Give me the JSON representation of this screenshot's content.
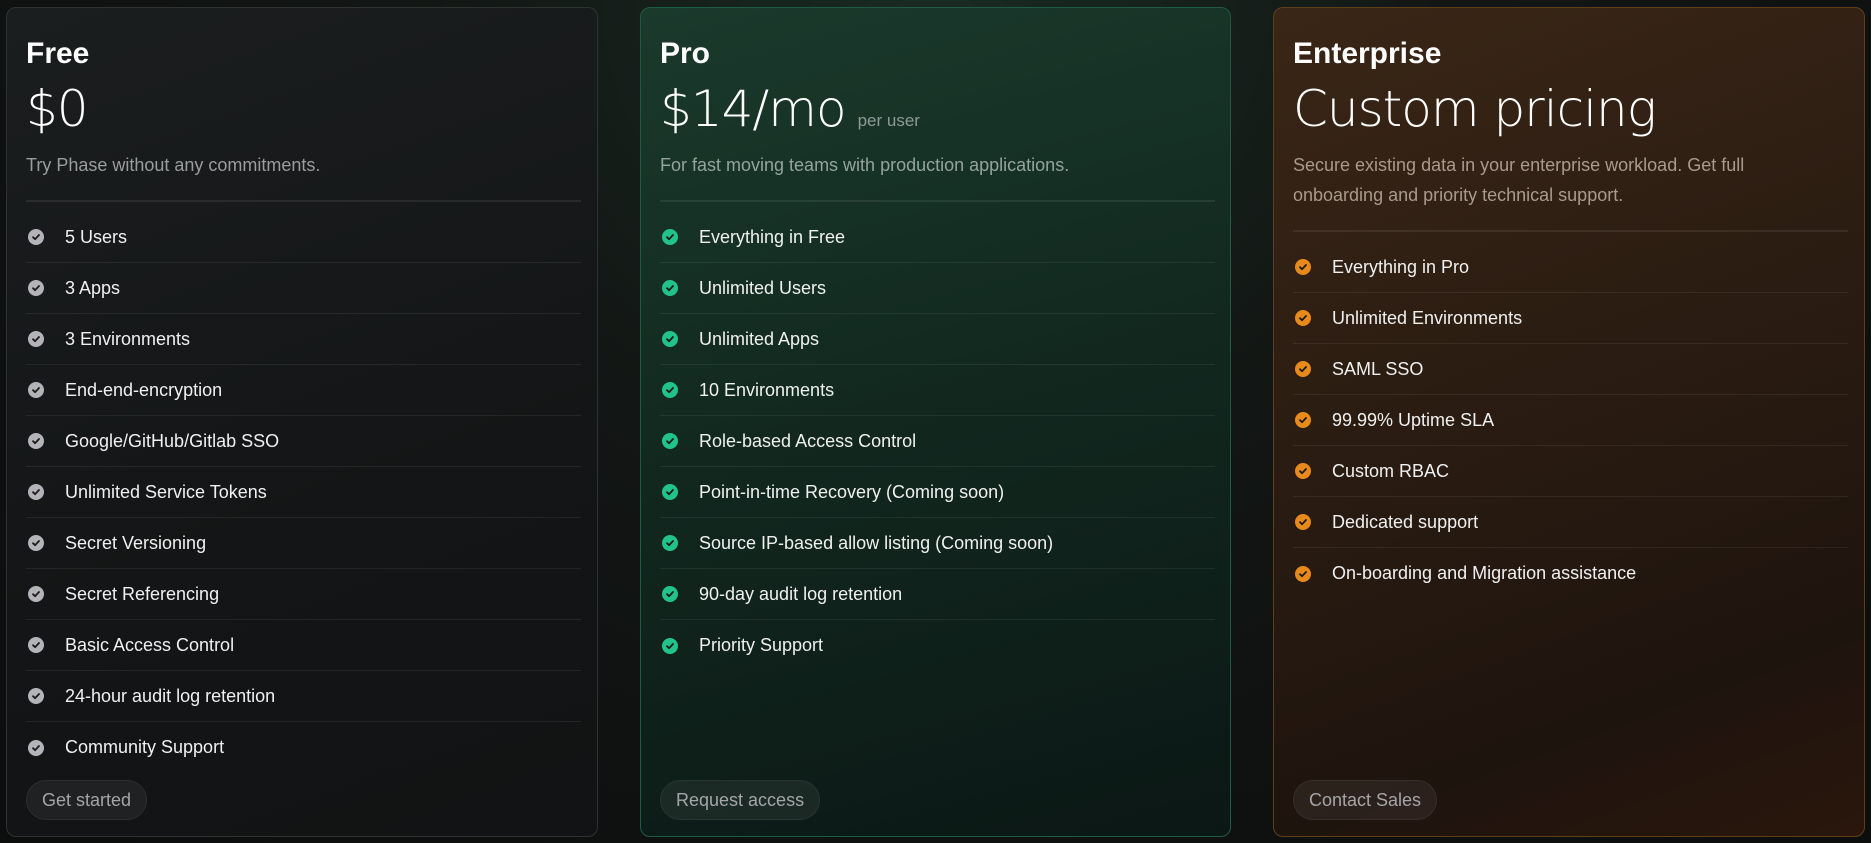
{
  "plans": [
    {
      "name": "Free",
      "price": "$0",
      "price_suffix": "",
      "description": "Try Phase without any commitments.",
      "accent_color": "#b4b4b8",
      "features": [
        "5 Users",
        "3 Apps",
        "3 Environments",
        "End-end-encryption",
        "Google/GitHub/Gitlab SSO",
        "Unlimited Service Tokens",
        "Secret Versioning",
        "Secret Referencing",
        "Basic Access Control",
        "24-hour audit log retention",
        "Community Support"
      ],
      "cta_label": "Get started"
    },
    {
      "name": "Pro",
      "price": "$14/mo",
      "price_suffix": "per user",
      "description": "For fast moving teams with production applications.",
      "accent_color": "#22c38a",
      "features": [
        "Everything in Free",
        "Unlimited Users",
        "Unlimited Apps",
        "10 Environments",
        "Role-based Access Control",
        "Point-in-time Recovery (Coming soon)",
        "Source IP-based allow listing (Coming soon)",
        "90-day audit log retention",
        "Priority Support"
      ],
      "cta_label": "Request access"
    },
    {
      "name": "Enterprise",
      "price": "Custom pricing",
      "price_suffix": "",
      "description": "Secure existing data in your enterprise workload. Get full onboarding and priority technical support.",
      "accent_color": "#e8891c",
      "features": [
        "Everything in Pro",
        "Unlimited Environments",
        "SAML SSO",
        "99.99% Uptime SLA",
        "Custom RBAC",
        "Dedicated support",
        "On-boarding and Migration assistance"
      ],
      "cta_label": "Contact Sales"
    }
  ]
}
